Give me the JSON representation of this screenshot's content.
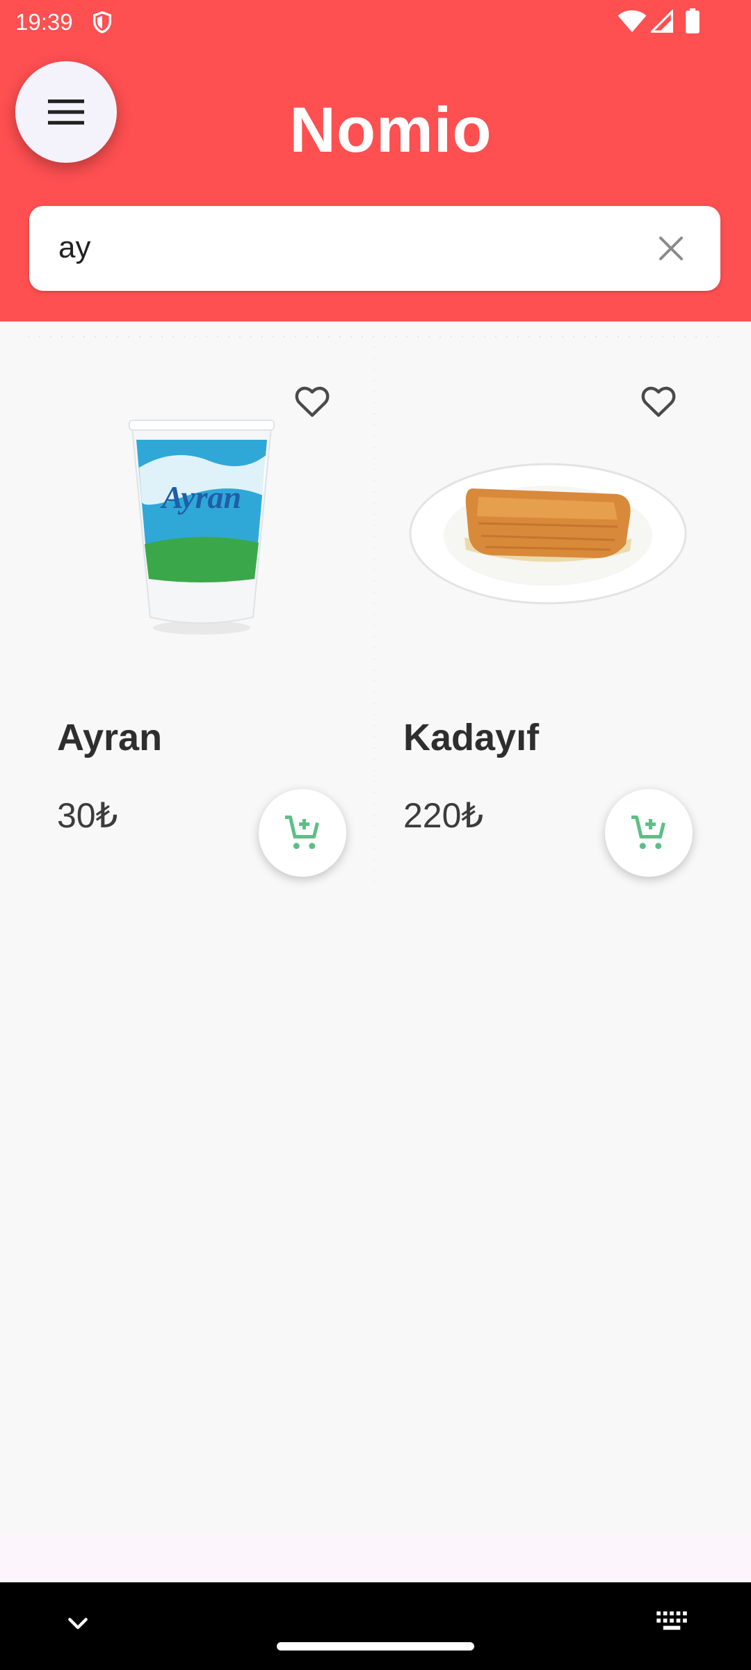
{
  "status_bar": {
    "time": "19:39"
  },
  "header": {
    "title": "Nomio"
  },
  "search": {
    "value": "ay"
  },
  "products": [
    {
      "name": "Ayran",
      "price": "30₺"
    },
    {
      "name": "Kadayıf",
      "price": "220₺"
    }
  ],
  "colors": {
    "header_red": "#fe4f51",
    "cart_green": "#5dbf86",
    "background": "#f8f8f8"
  },
  "icons": [
    "shield-icon",
    "wifi-icon",
    "signal-icon",
    "battery-icon",
    "menu-icon",
    "close-icon",
    "heart-outline-icon",
    "add-shopping-cart-icon",
    "chevron-down-icon",
    "keyboard-icon"
  ]
}
